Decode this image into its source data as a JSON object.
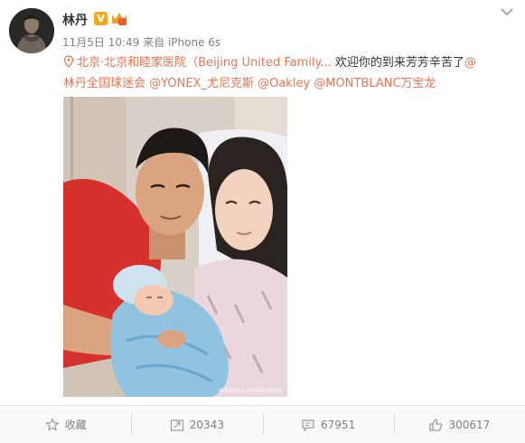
{
  "post": {
    "username": "林丹",
    "verified_label": "V",
    "timestamp": "11月5日 10:49",
    "source": "来自 iPhone 6s",
    "location": "北京·北京和睦家医院（Beijing United Family...",
    "text_line1": " 欢迎你的到来芳芳辛苦了",
    "mention_inline": "@",
    "mention_line2": "林丹全国球迷会",
    "mentions": [
      "@YONEX_尤尼克斯",
      "@Oakley",
      "@MONTBLANC万宝龙"
    ],
    "watermark": "weibo.com/lindan"
  },
  "actions": {
    "favorite_label": "收藏",
    "repost_count": "20343",
    "comment_count": "67951",
    "like_count": "300617"
  },
  "icons": {
    "menu": "chevron-down-icon",
    "location": "location-pin-icon",
    "favorite": "star-icon",
    "repost": "repost-icon",
    "comment": "comment-icon",
    "like": "thumbs-up-icon"
  },
  "colors": {
    "link": "#eb7350",
    "verified": "#f5a623",
    "meta": "#808080"
  }
}
